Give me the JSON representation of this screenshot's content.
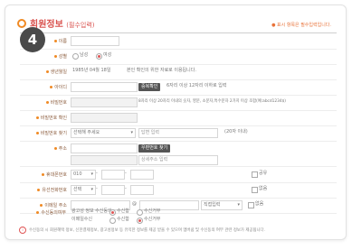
{
  "step_number": "4",
  "header": {
    "title": "회원정보",
    "title_sub": "(필수입력)",
    "required_note": "● 표시 항목은 필수입력입니다."
  },
  "fields": {
    "name": {
      "label": "이름"
    },
    "gender": {
      "label": "성별",
      "options": [
        "남성",
        "여성"
      ],
      "selected": "여성"
    },
    "birth": {
      "label": "생년월일",
      "value": "1985년 04월 18일",
      "note": "본인 확인의 위한 자료로 이용됩니다."
    },
    "user_id": {
      "label": "아이디",
      "button": "중복확인",
      "note": "6자리 이상 12자리 이하로 입력"
    },
    "password": {
      "label": "비밀번호",
      "note": "8자리 이상 20자리 이내의 숫자, 영문, 소문자,특수문자 2가지 이상 조합(예:abcd1234$)"
    },
    "password_confirm": {
      "label": "비밀번호 확인"
    },
    "pw_question": {
      "label": "비밀번호 찾기",
      "select": "선택해 주세요",
      "placeholder": "답변 입력",
      "note": "(20자 이내)"
    },
    "address": {
      "label": "주소",
      "button": "우편번호 찾기",
      "detail_placeholder": "상세주소 입력"
    },
    "mobile": {
      "label": "휴대폰번호",
      "prefix": "010",
      "sms_label": "공유"
    },
    "home_phone": {
      "label": "유선전화번호",
      "prefix": "선택",
      "chk_label": "없음"
    },
    "email": {
      "label": "이메일 주소",
      "at": "@",
      "domain_select": "직접입력",
      "chk_label": "없음"
    },
    "receive": {
      "label": "수신동의여부",
      "sms": {
        "tag": "광고성 정보 수신동의",
        "opt1": "수신함",
        "opt2": "수신거부"
      },
      "email": {
        "tag": "이메일수신",
        "opt1": "수신함",
        "opt2": "수신거부"
      }
    }
  },
  "footer_note": "수신동의 시 회원혜택 정보, 신한결제정보, 광고성정보 등 유익한 정보를 제공 받을 수 있으며 멤버쉽 및 수신동의 여부 관련 정보가 제공됩니다.",
  "colors": {
    "accent": "#f08a24",
    "red": "#e05555",
    "dark_button": "#555555"
  }
}
